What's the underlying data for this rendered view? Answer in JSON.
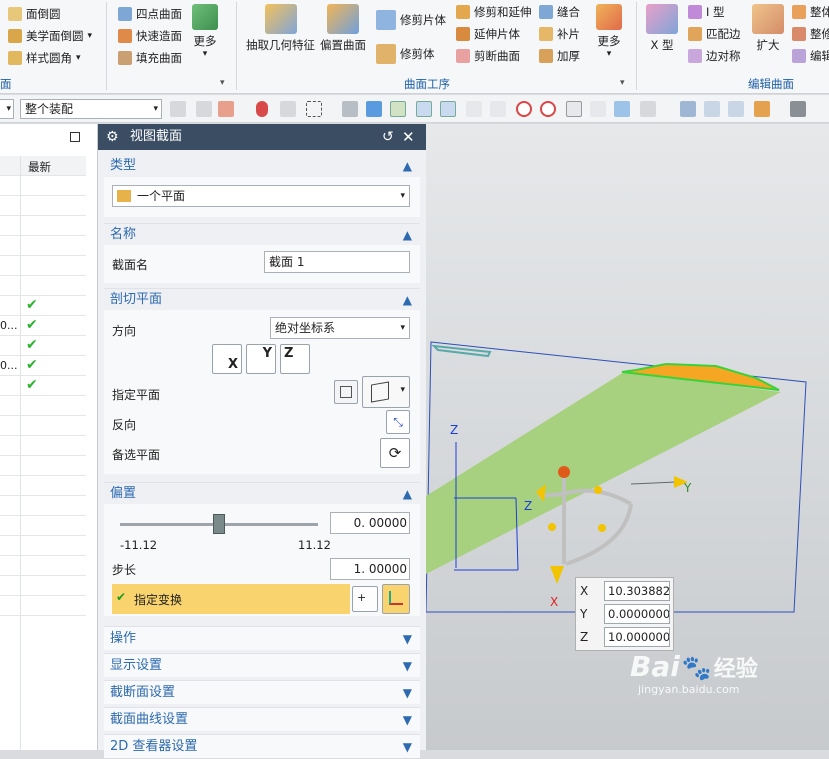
{
  "ribbon": {
    "col1": {
      "items": [
        "面倒圆",
        "美学面倒圆",
        "样式圆角"
      ]
    },
    "col2": {
      "items": [
        "四点曲面",
        "快速造面",
        "填充曲面"
      ]
    },
    "more1": "更多",
    "big": {
      "extract": "抽取几何特征",
      "offset": "偏置曲面"
    },
    "col3": {
      "items": [
        "修剪片体",
        "修剪体"
      ]
    },
    "col4": {
      "items": [
        "修剪和延伸",
        "延伸片体",
        "剪断曲面"
      ]
    },
    "col5": {
      "items": [
        "缝合",
        "补片",
        "加厚"
      ]
    },
    "more2": "更多",
    "xshape": "X 型",
    "col6": {
      "items": [
        "I 型",
        "匹配边",
        "边对称"
      ]
    },
    "expand": "扩大",
    "col7": {
      "items": [
        "整体",
        "整修",
        "编辑"
      ]
    },
    "groups": {
      "surface_ops": "曲面工序",
      "edit_surface": "编辑曲面",
      "left_partial": "面"
    }
  },
  "toolbar": {
    "filter": "整个装配"
  },
  "nav": {
    "header": "最新",
    "rows": [
      {
        "text": "",
        "check": false
      },
      {
        "text": "",
        "check": false
      },
      {
        "text": "",
        "check": false
      },
      {
        "text": "",
        "check": false
      },
      {
        "text": "",
        "check": false
      },
      {
        "text": "",
        "check": false
      },
      {
        "text": "",
        "check": true
      },
      {
        "text": "0...",
        "check": true
      },
      {
        "text": "",
        "check": true
      },
      {
        "text": "0...",
        "check": true
      },
      {
        "text": "",
        "check": true
      }
    ]
  },
  "dialog": {
    "title": "视图截面",
    "type": {
      "header": "类型",
      "value": "一个平面"
    },
    "name": {
      "header": "名称",
      "label": "截面名",
      "value": "截面 1"
    },
    "cut_plane": {
      "header": "剖切平面",
      "direction_label": "方向",
      "direction_value": "绝对坐标系",
      "axis_buttons": [
        "X",
        "Y",
        "Z"
      ],
      "specify_plane": "指定平面",
      "reverse": "反向",
      "alternate_plane": "备选平面"
    },
    "offset": {
      "header": "偏置",
      "value": "0. 00000",
      "slider_level": 0.5,
      "min": "-11.12",
      "max": "11.12",
      "step_label": "步长",
      "step_value": "1. 00000",
      "specify_transform": "指定变换"
    },
    "collapsed": [
      "操作",
      "显示设置",
      "截断面设置",
      "截面曲线设置",
      "2D 查看器设置"
    ]
  },
  "coords": {
    "x_label": "X",
    "x": "10.303882",
    "y_label": "Y",
    "y": "0.0000000",
    "z_label": "Z",
    "z": "10.000000"
  },
  "viewport": {
    "axis_z": "Z",
    "axis_y": "Y",
    "axis_x": "X",
    "axis_z2": "Z"
  },
  "watermark": {
    "brand": "Bai",
    "brand2": "经验",
    "url": "jingyan.baidu.com"
  },
  "colors": {
    "title_bar": "#3a4d63",
    "accent": "#2d6ab0",
    "highlight": "#f9d36e",
    "plane": "#a7d17f"
  }
}
